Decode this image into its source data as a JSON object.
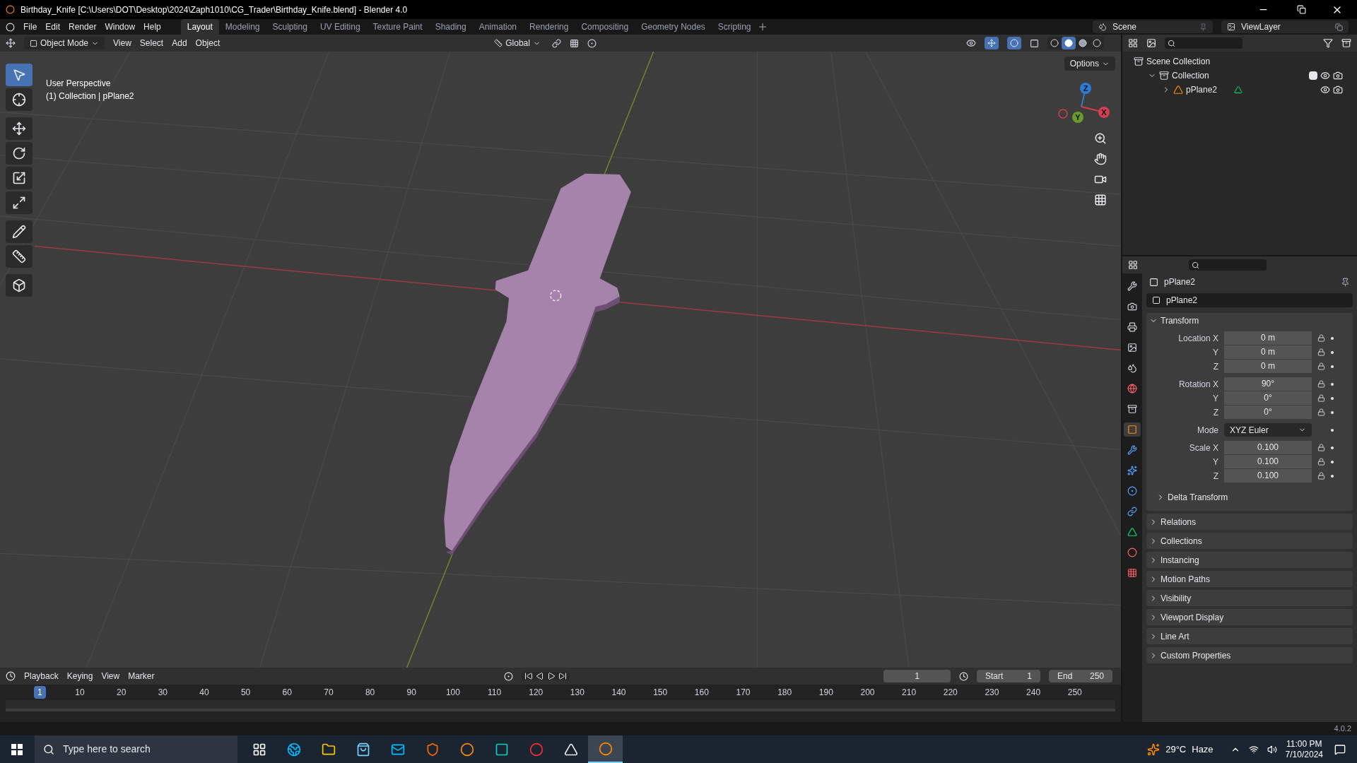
{
  "window": {
    "title": "Birthday_Knife [C:\\Users\\DOT\\Desktop\\2024\\Zaph1010\\CG_Trader\\Birthday_Knife.blend] - Blender 4.0"
  },
  "menu": [
    "File",
    "Edit",
    "Render",
    "Window",
    "Help"
  ],
  "workspaces": [
    {
      "label": "Layout",
      "selected": true
    },
    {
      "label": "Modeling",
      "selected": false
    },
    {
      "label": "Sculpting",
      "selected": false
    },
    {
      "label": "UV Editing",
      "selected": false
    },
    {
      "label": "Texture Paint",
      "selected": false
    },
    {
      "label": "Shading",
      "selected": false
    },
    {
      "label": "Animation",
      "selected": false
    },
    {
      "label": "Rendering",
      "selected": false
    },
    {
      "label": "Compositing",
      "selected": false
    },
    {
      "label": "Geometry Nodes",
      "selected": false
    },
    {
      "label": "Scripting",
      "selected": false
    }
  ],
  "scene": {
    "label": "Scene"
  },
  "view_layer": {
    "label": "ViewLayer"
  },
  "viewport_header": {
    "mode": "Object Mode",
    "menus": [
      "View",
      "Select",
      "Add",
      "Object"
    ],
    "orientation": "Global",
    "shading": [
      {
        "kind": "wireframe",
        "selected": false
      },
      {
        "kind": "solid",
        "selected": true
      },
      {
        "kind": "material",
        "selected": false
      },
      {
        "kind": "rendered",
        "selected": false
      }
    ]
  },
  "viewport": {
    "options": "Options",
    "info": [
      "User Perspective",
      "(1) Collection | pPlane2"
    ],
    "gizmo": [
      "Z",
      "Y",
      "X"
    ],
    "tools": [
      {
        "kind": "select",
        "selected": true
      },
      {
        "kind": "cursor",
        "selected": false
      },
      {
        "kind": "move",
        "selected": false
      },
      {
        "kind": "rotate",
        "selected": false
      },
      {
        "kind": "scale",
        "selected": false
      },
      {
        "kind": "transform",
        "selected": false
      },
      {
        "kind": "annotate",
        "selected": false
      },
      {
        "kind": "measure",
        "selected": false
      },
      {
        "kind": "add-cube",
        "selected": false
      }
    ]
  },
  "outliner": {
    "tree": [
      {
        "label": "Scene Collection",
        "kind": "scene",
        "children": [
          {
            "label": "Collection",
            "kind": "collection",
            "expanded": true,
            "checked": true,
            "children": [
              {
                "label": "pPlane2",
                "kind": "mesh",
                "expanded": false
              }
            ]
          }
        ]
      }
    ]
  },
  "properties": {
    "object_name": "pPlane2",
    "data_name": "pPlane2",
    "tabs": [
      {
        "kind": "tool",
        "selected": false
      },
      {
        "kind": "render",
        "selected": false
      },
      {
        "kind": "output",
        "selected": false
      },
      {
        "kind": "view-layer",
        "selected": false
      },
      {
        "kind": "scene",
        "selected": false
      },
      {
        "kind": "world",
        "selected": false
      },
      {
        "kind": "collection",
        "selected": false
      },
      {
        "kind": "object",
        "selected": true
      },
      {
        "kind": "modifiers",
        "selected": false
      },
      {
        "kind": "particles",
        "selected": false
      },
      {
        "kind": "physics",
        "selected": false
      },
      {
        "kind": "constraints",
        "selected": false
      },
      {
        "kind": "data",
        "selected": false
      },
      {
        "kind": "material",
        "selected": false
      },
      {
        "kind": "texture",
        "selected": false
      }
    ],
    "transform": {
      "label": "Transform",
      "expanded": true,
      "groups": [
        {
          "rows": [
            {
              "kind": "field",
              "label": "Location X",
              "value": "0 m"
            },
            {
              "kind": "field",
              "label": "Y",
              "value": "0 m"
            },
            {
              "kind": "field",
              "label": "Z",
              "value": "0 m"
            }
          ]
        },
        {
          "rows": [
            {
              "kind": "field",
              "label": "Rotation X",
              "value": "90°"
            },
            {
              "kind": "field",
              "label": "Y",
              "value": "0°"
            },
            {
              "kind": "field",
              "label": "Z",
              "value": "0°"
            }
          ]
        },
        {
          "rows": [
            {
              "kind": "select",
              "label": "Mode",
              "value": "XYZ Euler"
            }
          ]
        },
        {
          "rows": [
            {
              "kind": "field",
              "label": "Scale X",
              "value": "0.100"
            },
            {
              "kind": "field",
              "label": "Y",
              "value": "0.100"
            },
            {
              "kind": "field",
              "label": "Z",
              "value": "0.100"
            }
          ]
        }
      ],
      "subpanel": {
        "label": "Delta Transform",
        "expanded": false
      }
    },
    "panels": [
      {
        "label": "Relations",
        "expanded": false
      },
      {
        "label": "Collections",
        "expanded": false
      },
      {
        "label": "Instancing",
        "expanded": false
      },
      {
        "label": "Motion Paths",
        "expanded": false
      },
      {
        "label": "Visibility",
        "expanded": false
      },
      {
        "label": "Viewport Display",
        "expanded": false
      },
      {
        "label": "Line Art",
        "expanded": false
      },
      {
        "label": "Custom Properties",
        "expanded": false
      }
    ]
  },
  "timeline": {
    "menus": [
      "Playback",
      "Keying",
      "View",
      "Marker"
    ],
    "current_frame": "1",
    "start_label": "Start",
    "start": "1",
    "end_label": "End",
    "end": "250",
    "playhead": "1",
    "ticks": [
      "10",
      "20",
      "30",
      "40",
      "50",
      "60",
      "70",
      "80",
      "90",
      "100",
      "110",
      "120",
      "130",
      "140",
      "150",
      "160",
      "170",
      "180",
      "190",
      "200",
      "210",
      "220",
      "230",
      "240",
      "250"
    ]
  },
  "status_bar": {
    "version": "4.0.2"
  },
  "taskbar": {
    "search": {
      "placeholder": "Type here to search"
    },
    "apps": [
      {
        "kind": "task-view",
        "active": false
      },
      {
        "kind": "edge",
        "active": false
      },
      {
        "kind": "explorer",
        "active": false
      },
      {
        "kind": "store",
        "active": false
      },
      {
        "kind": "mail",
        "active": false
      },
      {
        "kind": "brave",
        "active": false
      },
      {
        "kind": "blender",
        "active": false
      },
      {
        "kind": "maya",
        "active": false
      },
      {
        "kind": "heart-app",
        "active": false
      },
      {
        "kind": "zbrush",
        "active": false
      },
      {
        "kind": "blender",
        "active": true
      }
    ],
    "temperature": "29°C",
    "weather": "Haze",
    "time": "11:00 PM",
    "date": "7/10/2024"
  }
}
